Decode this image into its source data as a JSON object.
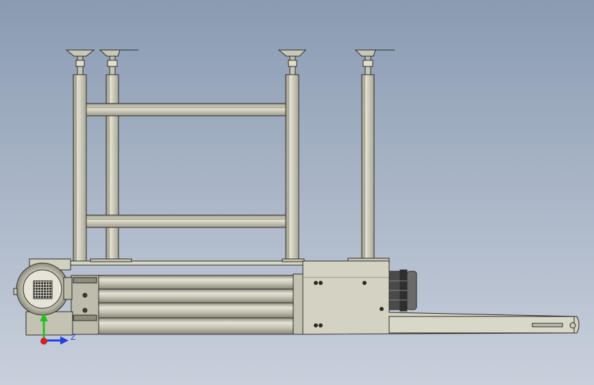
{
  "viewport": {
    "background_top": "#8a9bb2",
    "background_bottom": "#c9d0dc"
  },
  "model": {
    "metal_light": "#d6d4c4",
    "metal_mid": "#b8b6a6",
    "metal_dark": "#8d8b7c",
    "outline": "#2a2a26",
    "motor_dark": "#3c3c3c"
  },
  "triad": {
    "x_axis_color": "#d02020",
    "y_axis_color": "#20c020",
    "z_axis_color": "#2040e0",
    "z_label": "Z"
  }
}
